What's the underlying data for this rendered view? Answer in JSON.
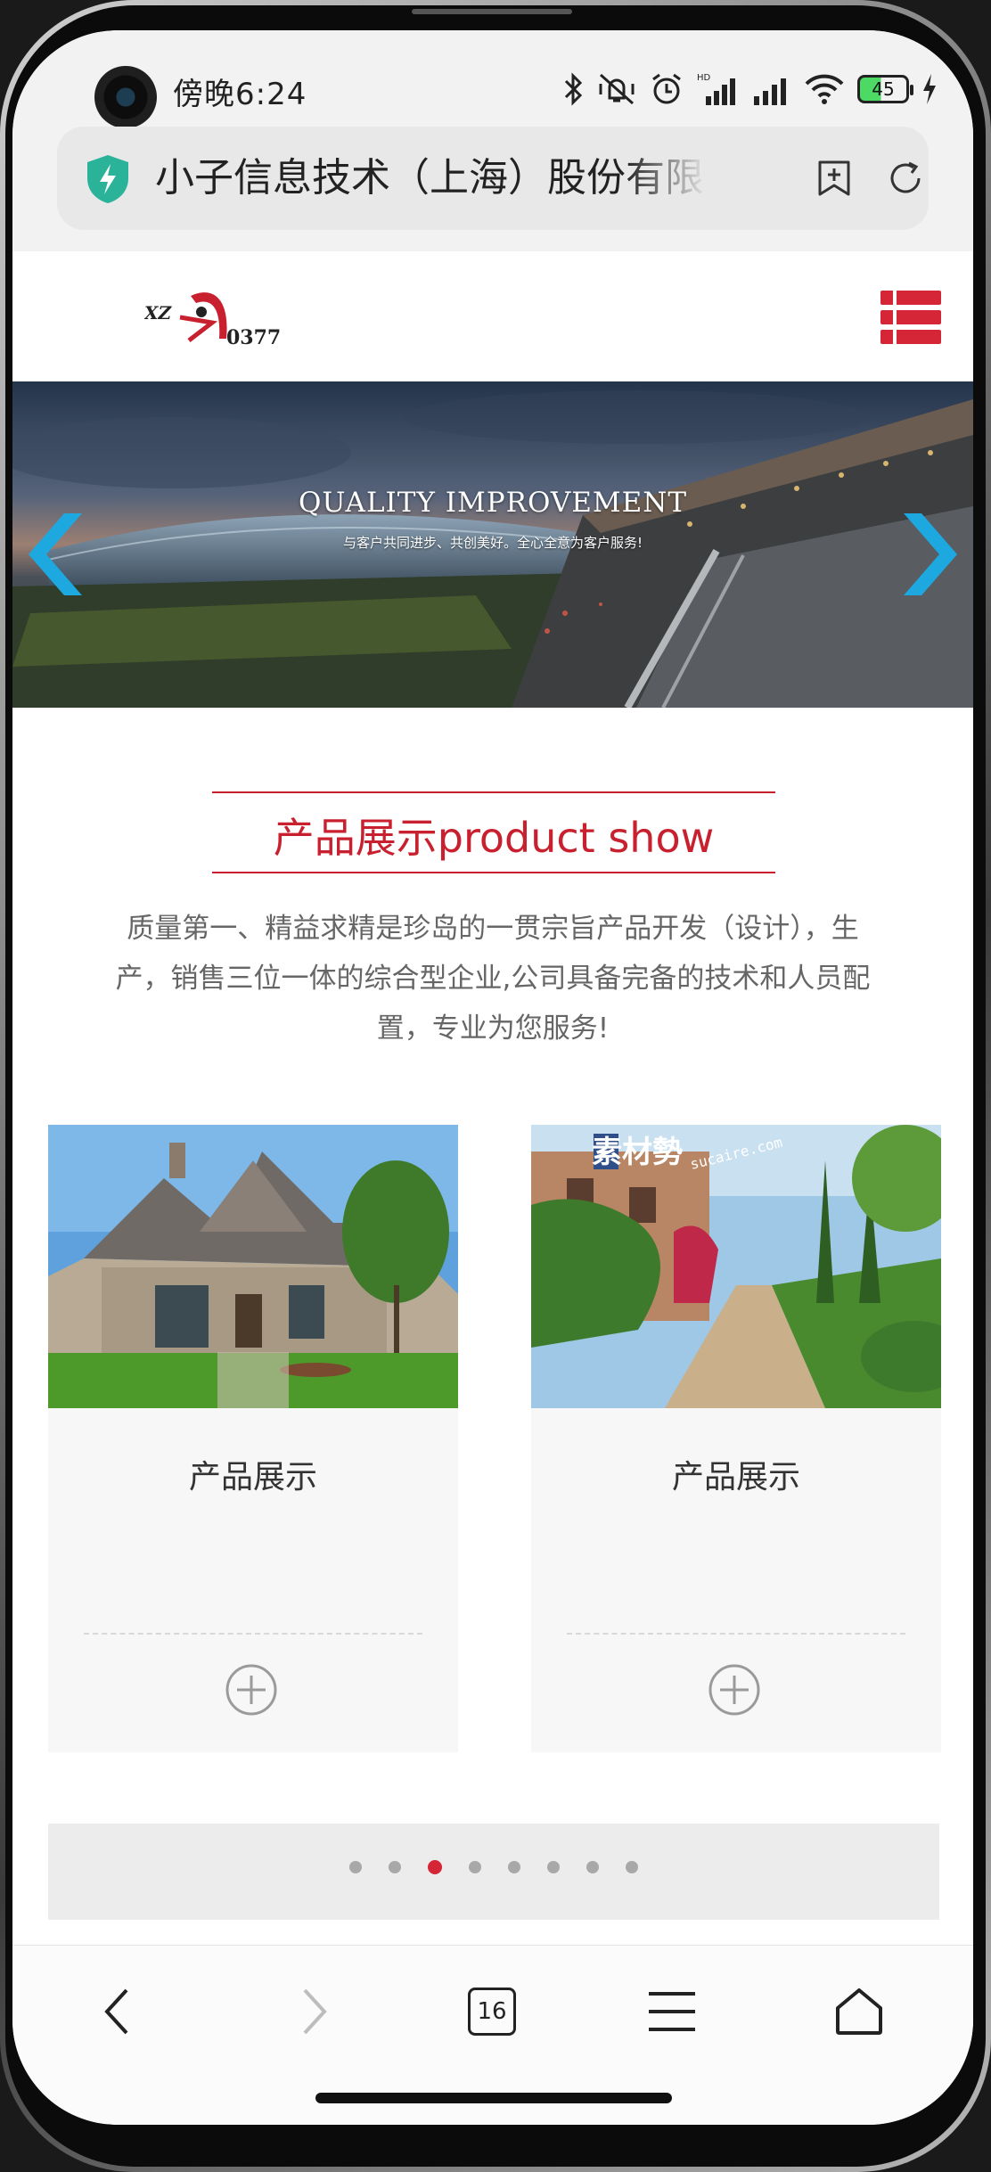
{
  "status_bar": {
    "time": "傍晚6:24",
    "battery": "45"
  },
  "address_bar": {
    "title": "小子信息技术（上海）股份有限公司"
  },
  "site": {
    "logo_text": "XZ 0377",
    "banner": {
      "title": "QUALITY IMPROVEMENT",
      "subtitle": "与客户共同进步、共创美好。全心全意为客户服务!"
    },
    "section": {
      "title": "产品展示product show",
      "description": "质量第一、精益求精是珍岛的一贯宗旨产品开发（设计），生产，销售三位一体的综合型企业,公司具备完备的技术和人员配置，专业为您服务!"
    },
    "products": [
      {
        "title": "产品展示",
        "image": "house-photo"
      },
      {
        "title": "产品展示",
        "image": "garden-path-photo",
        "watermark": "素材勢",
        "watermark_url": "sucaire.com"
      }
    ],
    "pager": {
      "count": 8,
      "active_index": 2
    }
  },
  "bottom_nav": {
    "tabs_count": "16"
  },
  "colors": {
    "brand_red": "#c8202e",
    "arrow_blue": "#1ea8e0"
  }
}
